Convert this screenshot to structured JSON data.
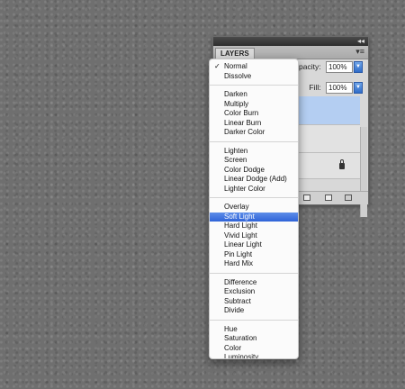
{
  "panel": {
    "tab_label": "LAYERS",
    "opacity_label": "Opacity:",
    "opacity_value": "100%",
    "fill_label": "Fill:",
    "fill_value": "100%"
  },
  "blend_menu": {
    "selected": "Normal",
    "highlighted": "Soft Light",
    "groups": [
      [
        "Normal",
        "Dissolve"
      ],
      [
        "Darken",
        "Multiply",
        "Color Burn",
        "Linear Burn",
        "Darker Color"
      ],
      [
        "Lighten",
        "Screen",
        "Color Dodge",
        "Linear Dodge (Add)",
        "Lighter Color"
      ],
      [
        "Overlay",
        "Soft Light",
        "Hard Light",
        "Vivid Light",
        "Linear Light",
        "Pin Light",
        "Hard Mix"
      ],
      [
        "Difference",
        "Exclusion",
        "Subtract",
        "Divide"
      ],
      [
        "Hue",
        "Saturation",
        "Color",
        "Luminosity"
      ]
    ]
  },
  "colors": {
    "highlight": "#3a6fdc",
    "selected_layer": "#b4cef2"
  }
}
